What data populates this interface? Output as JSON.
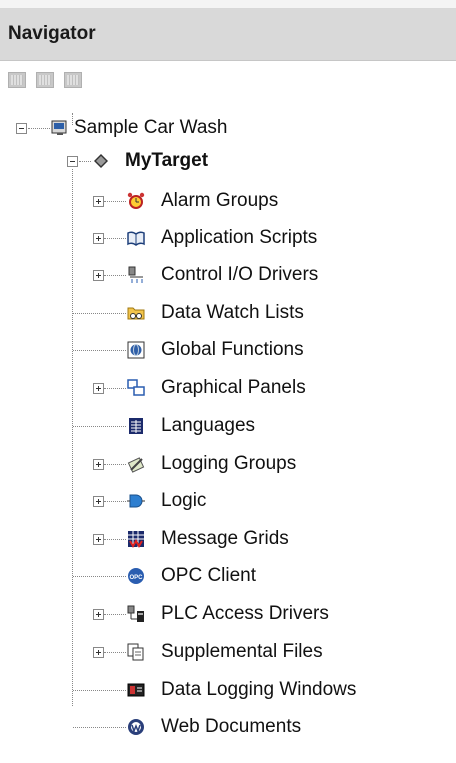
{
  "panel": {
    "title": "Navigator"
  },
  "toolbar": {
    "buttons": [
      "grid-view-icon",
      "tile-view-icon",
      "list-view-icon"
    ]
  },
  "tree": {
    "root": {
      "label": "Sample Car Wash",
      "icon": "project-icon"
    },
    "target": {
      "label": "MyTarget",
      "icon": "target-diamond-icon"
    },
    "items": [
      {
        "label": "Alarm Groups",
        "icon": "alarm-clock-icon",
        "expandable": true
      },
      {
        "label": "Application Scripts",
        "icon": "scripts-book-icon",
        "expandable": true
      },
      {
        "label": "Control I/O Drivers",
        "icon": "io-drivers-icon",
        "expandable": true
      },
      {
        "label": "Data Watch Lists",
        "icon": "watch-glasses-icon",
        "expandable": false
      },
      {
        "label": "Global Functions",
        "icon": "global-functions-icon",
        "expandable": false
      },
      {
        "label": "Graphical Panels",
        "icon": "panels-icon",
        "expandable": true
      },
      {
        "label": "Languages",
        "icon": "languages-icon",
        "expandable": false
      },
      {
        "label": "Logging Groups",
        "icon": "logging-groups-icon",
        "expandable": true
      },
      {
        "label": "Logic",
        "icon": "logic-gate-icon",
        "expandable": true
      },
      {
        "label": "Message Grids",
        "icon": "message-grids-icon",
        "expandable": true
      },
      {
        "label": "OPC Client",
        "icon": "opc-client-icon",
        "expandable": false
      },
      {
        "label": "PLC Access Drivers",
        "icon": "plc-drivers-icon",
        "expandable": true
      },
      {
        "label": "Supplemental Files",
        "icon": "supplemental-files-icon",
        "expandable": true
      },
      {
        "label": "Data Logging Windows",
        "icon": "data-logging-window-icon",
        "expandable": false
      },
      {
        "label": "Web Documents",
        "icon": "web-documents-icon",
        "expandable": false
      }
    ]
  },
  "colors": {
    "header_bg": "#d9d9d9",
    "text": "#111111",
    "tree_lines": "#888888"
  }
}
